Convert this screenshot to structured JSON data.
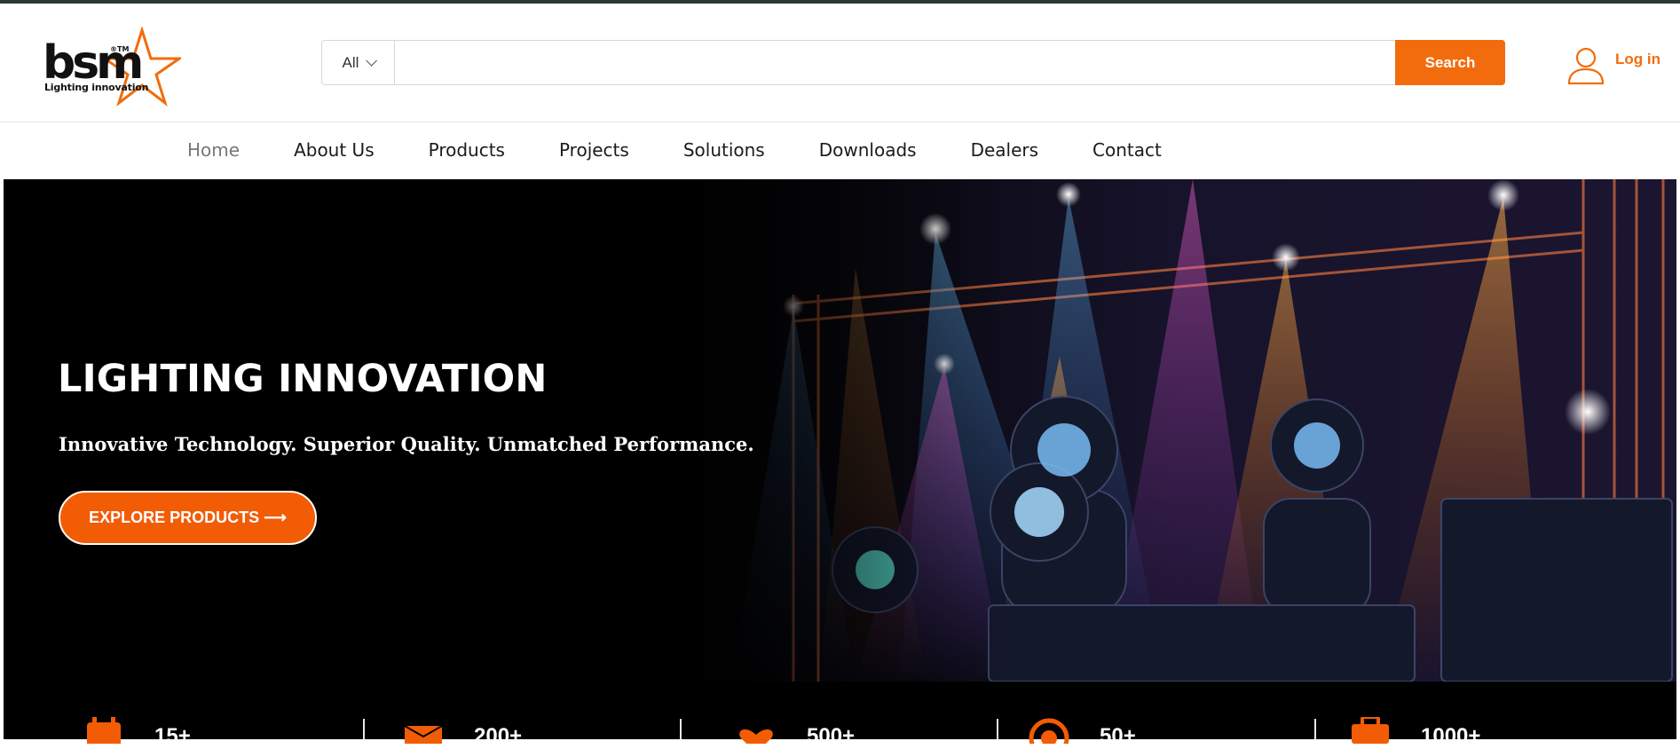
{
  "brand": {
    "logo_letters": "bsm",
    "trademark": "®TM",
    "tagline": "Lighting innovation",
    "accent_color": "#f26c0d"
  },
  "search": {
    "category": "All",
    "placeholder": "",
    "button_label": "Search"
  },
  "account": {
    "login_label": "Log in",
    "icon": "user-icon"
  },
  "nav": {
    "items": [
      {
        "label": "Home",
        "active": true
      },
      {
        "label": "About Us"
      },
      {
        "label": "Products"
      },
      {
        "label": "Projects"
      },
      {
        "label": "Solutions"
      },
      {
        "label": "Downloads"
      },
      {
        "label": "Dealers"
      },
      {
        "label": "Contact"
      }
    ]
  },
  "hero": {
    "title": "LIGHTING INNOVATION",
    "subtitle": "Innovative Technology. Superior Quality. Unmatched Performance.",
    "cta_label": "EXPLORE PRODUCTS ⟶",
    "image": "stage-moving-head-lights-photo"
  },
  "stats": [
    {
      "value": "15+",
      "icon": "calendar-icon"
    },
    {
      "value": "200+",
      "icon": "envelope-icon"
    },
    {
      "value": "500+",
      "icon": "heart-icon"
    },
    {
      "value": "50+",
      "icon": "globe-icon"
    },
    {
      "value": "1000+",
      "icon": "briefcase-icon"
    }
  ]
}
